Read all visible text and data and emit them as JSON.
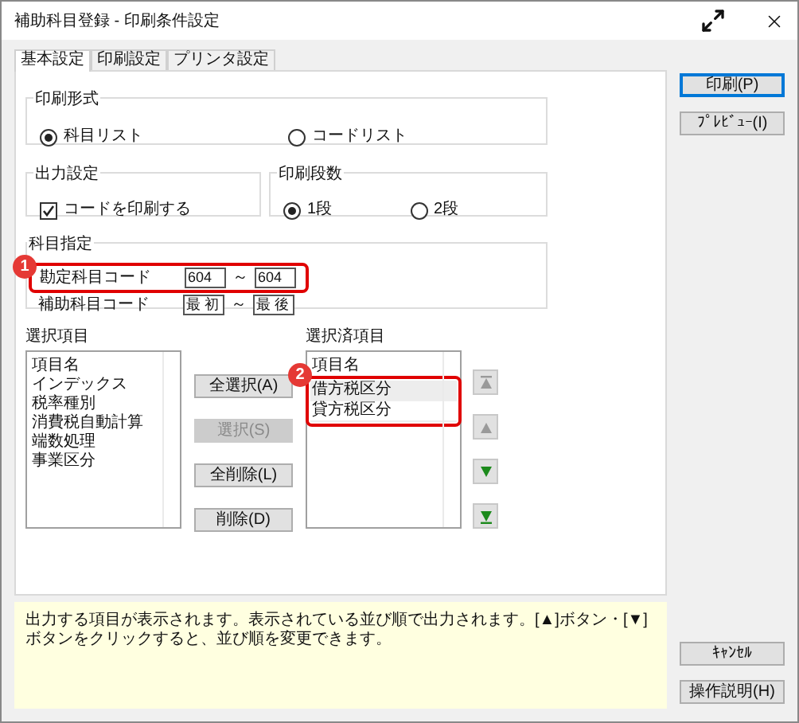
{
  "window": {
    "title": "補助科目登録 - 印刷条件設定"
  },
  "tabs": [
    {
      "label": "基本設定",
      "selected": true
    },
    {
      "label": "印刷設定",
      "selected": false
    },
    {
      "label": "プリンタ設定",
      "selected": false
    }
  ],
  "print_format": {
    "title": "印刷形式",
    "options": [
      {
        "label": "科目リスト",
        "selected": true
      },
      {
        "label": "コードリスト",
        "selected": false
      }
    ]
  },
  "output": {
    "title": "出力設定",
    "checkbox": {
      "label": "コードを印刷する",
      "checked": true
    }
  },
  "columns": {
    "title": "印刷段数",
    "options": [
      {
        "label": "1段",
        "selected": true
      },
      {
        "label": "2段",
        "selected": false
      }
    ]
  },
  "range": {
    "title": "科目指定",
    "rows": [
      {
        "label": "勘定科目コード",
        "from": "604",
        "separator": "～",
        "to": "604",
        "callout": "1"
      },
      {
        "label": "補助科目コード",
        "from": "最 初",
        "separator": "～",
        "to": "最 後"
      }
    ]
  },
  "available": {
    "title": "選択項目",
    "header": "項目名",
    "items": [
      "インデックス",
      "税率種別",
      "消費税自動計算",
      "端数処理",
      "事業区分"
    ]
  },
  "move_buttons": [
    {
      "label": "全選択(A)",
      "disabled": false
    },
    {
      "label": "選択(S)",
      "disabled": true
    },
    {
      "label": "全削除(L)",
      "disabled": false
    },
    {
      "label": "削除(D)",
      "disabled": false
    }
  ],
  "chosen": {
    "title": "選択済項目",
    "header": "項目名",
    "callout": "2",
    "items": [
      {
        "label": "借方税区分",
        "selected": true
      },
      {
        "label": "貸方税区分",
        "selected": false
      }
    ]
  },
  "order_buttons": [
    {
      "kind": "top",
      "disabled": true
    },
    {
      "kind": "up",
      "disabled": true
    },
    {
      "kind": "down",
      "disabled": false
    },
    {
      "kind": "bottom",
      "disabled": false
    }
  ],
  "side_buttons": [
    {
      "label": "印刷(P)",
      "default": true
    },
    {
      "label": "ﾌﾟﾚﾋﾞｭｰ(I)",
      "default": false
    }
  ],
  "help": "出力する項目が表示されます。表示されている並び順で出力されます。[▲]ボタン・[▼]ボタンをクリックすると、並び順を変更できます。",
  "footer_buttons": [
    {
      "label": "ｷｬﾝｾﾙ"
    },
    {
      "label": "操作説明(H)"
    }
  ]
}
